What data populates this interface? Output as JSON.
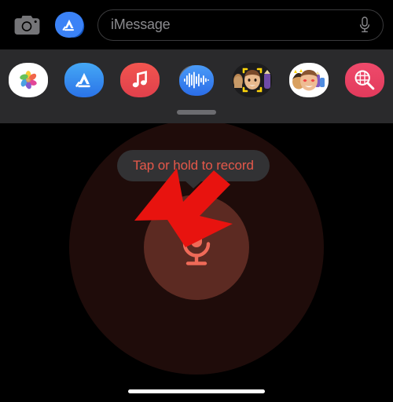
{
  "compose_bar": {
    "camera_icon": "camera-icon",
    "appstore_icon": "app-store-icon",
    "message_input": {
      "value": "",
      "placeholder": "iMessage"
    },
    "dictation_icon": "microphone-icon"
  },
  "app_drawer": {
    "grabber": "drawer-grabber-handle",
    "background_color": "#2a2a2c",
    "apps": [
      {
        "name": "Photos",
        "icon": "photos-icon",
        "selected": false
      },
      {
        "name": "App Store",
        "icon": "app-store-icon",
        "selected": false
      },
      {
        "name": "Music",
        "icon": "music-note-icon",
        "selected": false
      },
      {
        "name": "Audio",
        "icon": "audio-waveform-icon",
        "selected": true
      },
      {
        "name": "Memoji",
        "icon": "memoji-camera-icon",
        "selected": false
      },
      {
        "name": "Memoji Stickers",
        "icon": "memoji-stickers-icon",
        "selected": false
      },
      {
        "name": "#images",
        "icon": "images-search-icon",
        "selected": false
      }
    ]
  },
  "audio_panel": {
    "tooltip_text": "Tap or hold to record",
    "tooltip_text_color": "#e5584a",
    "tooltip_background_color": "#323234",
    "record_button_icon": "microphone-icon",
    "record_button_color": "#5c2a22",
    "record_halo_color": "#1f0c0a",
    "mic_glyph_color": "#ef6a58"
  },
  "annotation": {
    "arrow": "red-pointer-arrow",
    "arrow_color": "#e8130f",
    "points_to": "record-button"
  },
  "home_indicator": {
    "label": "home-indicator-bar",
    "color": "#ffffff"
  }
}
